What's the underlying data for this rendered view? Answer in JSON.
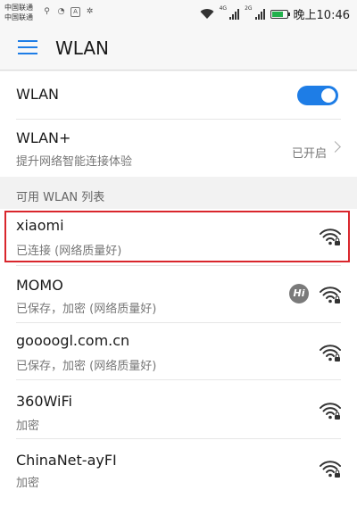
{
  "status_bar": {
    "carrier_1": "中国联通",
    "carrier_2": "中国联通",
    "network_tag_1": "4G",
    "network_tag_2": "2G",
    "time": "晚上10:46"
  },
  "header": {
    "title": "WLAN",
    "menu_icon": "hamburger-menu-icon"
  },
  "wlan_toggle": {
    "label": "WLAN",
    "enabled": true
  },
  "wlan_plus": {
    "title": "WLAN+",
    "subtitle": "提升网络智能连接体验",
    "status": "已开启"
  },
  "section": {
    "label": "可用 WLAN 列表"
  },
  "networks": [
    {
      "name": "xiaomi",
      "status": "已连接 (网络质量好)",
      "secured": true,
      "highlighted": true
    },
    {
      "name": "MOMO",
      "status": "已保存，加密 (网络质量好)",
      "secured": true,
      "badge": "Hi"
    },
    {
      "name": "goooogl.com.cn",
      "status": "已保存，加密 (网络质量好)",
      "secured": true
    },
    {
      "name": "360WiFi",
      "status": "加密",
      "secured": true
    },
    {
      "name": "ChinaNet-ayFI",
      "status": "加密",
      "secured": true
    }
  ],
  "colors": {
    "accent": "#1e7de6",
    "highlight_border": "#d9262c",
    "battery": "#22b14c"
  }
}
